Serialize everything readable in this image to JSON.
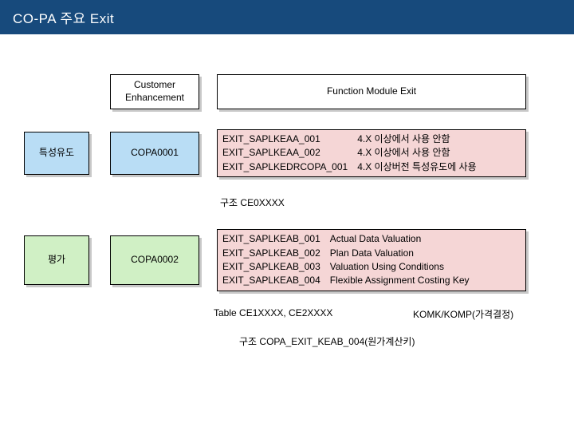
{
  "title": "CO-PA 주요 Exit",
  "headers": {
    "customer_enhancement": "Customer\nEnhancement",
    "function_module_exit": "Function Module Exit"
  },
  "rows": [
    {
      "category_label": "특성유도",
      "category_color": "blue",
      "enhancement_label": "COPA0001",
      "functions": [
        {
          "name": "EXIT_SAPLKEAA_001",
          "desc": "4.X 이상에서 사용 안함"
        },
        {
          "name": "EXIT_SAPLKEAA_002",
          "desc": "4.X 이상에서 사용 안함"
        },
        {
          "name": "EXIT_SAPLKEDRCOPA_001",
          "desc": "4.X 이상버전 특성유도에 사용"
        }
      ],
      "struct_note": "구조 CE0XXXX"
    },
    {
      "category_label": "평가",
      "category_color": "green",
      "enhancement_label": "COPA0002",
      "functions": [
        {
          "name": "EXIT_SAPLKEAB_001",
          "desc": "Actual Data Valuation"
        },
        {
          "name": "EXIT_SAPLKEAB_002",
          "desc": "Plan Data Valuation"
        },
        {
          "name": "EXIT_SAPLKEAB_003",
          "desc": "Valuation Using Conditions"
        },
        {
          "name": "EXIT_SAPLKEAB_004",
          "desc": "Flexible Assignment Costing Key"
        }
      ],
      "table_note_left": "Table  CE1XXXX, CE2XXXX",
      "table_note_right": "KOMK/KOMP(가격결정)",
      "struct_note2": "구조 COPA_EXIT_KEAB_004(원가계산키)"
    }
  ]
}
